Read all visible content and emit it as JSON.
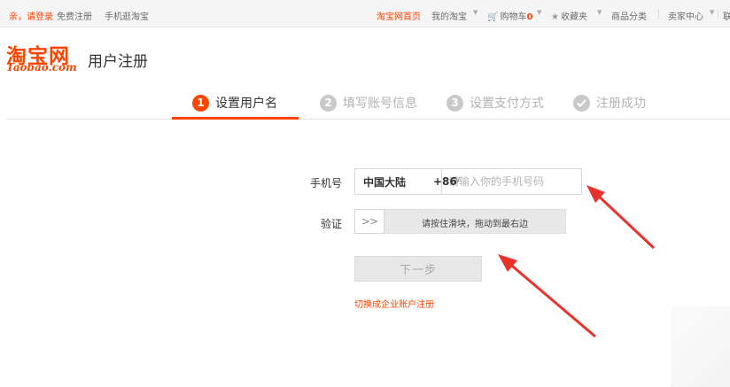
{
  "topbar": {
    "greeting": "亲，请登录",
    "register": "免费注册",
    "mobile": "手机逛淘宝",
    "home": "淘宝网首页",
    "my_taobao": "我的淘宝",
    "cart_label": "购物车",
    "cart_count": "0",
    "favorites": "收藏夹",
    "categories": "商品分类",
    "seller": "卖家中心",
    "contact": "联"
  },
  "logo": {
    "cn": "淘宝网",
    "en": "Taobao.com"
  },
  "page_title": "用户注册",
  "steps": [
    {
      "num": "1",
      "label": "设置用户名",
      "active": true
    },
    {
      "num": "2",
      "label": "填写账号信息",
      "active": false
    },
    {
      "num": "3",
      "label": "设置支付方式",
      "active": false
    },
    {
      "num": "",
      "label": "注册成功",
      "active": false
    }
  ],
  "form": {
    "phone_label": "手机号",
    "country_name": "中国大陆",
    "country_code": "+86",
    "phone_placeholder": "请输入你的手机号码",
    "verify_label": "验证",
    "slider_handle": ">>",
    "slider_hint": "请按住滑块，拖动到最右边",
    "next_button": "下一步",
    "switch_link": "切换成企业账户注册"
  },
  "colors": {
    "accent": "#ff4400",
    "annotation": "#e8332d"
  }
}
